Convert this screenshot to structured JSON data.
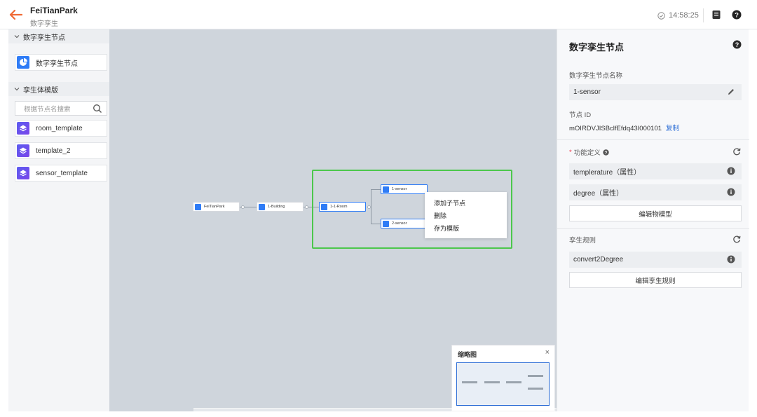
{
  "header": {
    "title": "FeiTianPark",
    "subtitle": "数字孪生",
    "time": "14:58:25"
  },
  "left_panel": {
    "section1_title": "数字孪生节点",
    "twin_node_label": "数字孪生节点",
    "section2_title": "孪生体模版",
    "search_placeholder": "根据节点名搜索",
    "templates": [
      "room_template",
      "template_2",
      "sensor_template"
    ]
  },
  "canvas": {
    "nodes": {
      "root": "FeiTianPark",
      "building": "1-Building",
      "room": "1-1-Room",
      "sensor1": "1-sensor",
      "sensor2": "2-sensor"
    },
    "context_menu": [
      "添加子节点",
      "删除",
      "存为模版"
    ],
    "minimap_title": "缩略图",
    "minimap_close": "×"
  },
  "right_panel": {
    "title": "数字孪生节点",
    "name_label": "数字孪生节点名称",
    "name_value": "1-sensor",
    "id_label": "节点 ID",
    "id_value": "mOIRDVJISBclfEfdq43I000101",
    "copy_label": "复制",
    "func_label": "功能定义",
    "func_required": "*",
    "properties": [
      "templerature（属性）",
      "degree（属性）"
    ],
    "edit_model_label": "编辑物模型",
    "rules_label": "孪生规则",
    "rules": [
      "convert2Degree"
    ],
    "edit_rules_label": "编辑孪生规则"
  },
  "colors": {
    "accent": "#2f7cf6",
    "back_arrow": "#f06a35",
    "selection": "#4cc74c",
    "template_icon": "#6a50ee"
  },
  "icons": [
    "back-arrow-icon",
    "clock-check-icon",
    "document-icon",
    "help-icon",
    "chevron-down-icon",
    "search-icon",
    "pie-node-icon",
    "layers-icon",
    "edit-pencil-icon",
    "info-icon",
    "refresh-icon",
    "close-icon"
  ]
}
